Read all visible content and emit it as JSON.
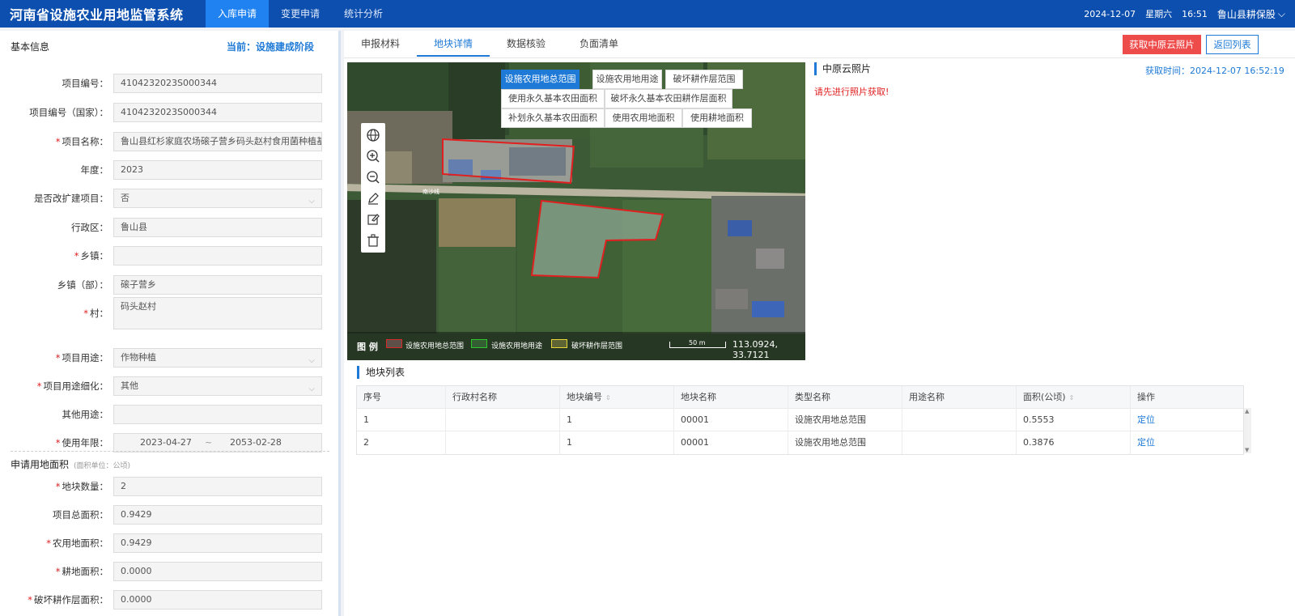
{
  "app": {
    "title": "河南省设施农业用地监管系统",
    "nav": [
      "入库申请",
      "变更申请",
      "统计分析"
    ],
    "date": "2024-12-07",
    "weekday": "星期六",
    "time": "16:51",
    "user": "鲁山县耕保股",
    "user_chevron": "⌵"
  },
  "left": {
    "section_title": "基本信息",
    "stage": "当前：设施建成阶段",
    "fields": [
      {
        "label": "项目编号：",
        "value": "4104232023S000344",
        "required": false
      },
      {
        "label": "项目编号（国家）：",
        "value": "4104232023S000344",
        "required": false
      },
      {
        "label": "项目名称：",
        "value": "鲁山县红杉家庭农场磙子营乡码头赵村食用菌种植基地",
        "required": true
      },
      {
        "label": "年度：",
        "value": "2023",
        "required": false
      },
      {
        "label": "是否改扩建项目：",
        "value": "否",
        "required": false,
        "select": true
      },
      {
        "label": "行政区：",
        "value": "鲁山县",
        "required": false
      },
      {
        "label": "乡镇：",
        "value": "",
        "required": true
      },
      {
        "label": "乡镇（部）：",
        "value": "磙子营乡",
        "required": false
      },
      {
        "label": "村：",
        "value": "码头赵村",
        "required": true
      },
      {
        "label": "项目用途：",
        "value": "作物种植",
        "required": true,
        "select": true
      },
      {
        "label": "项目用途细化：",
        "value": "其他",
        "required": true,
        "select": true
      },
      {
        "label": "其他用途：",
        "value": "",
        "required": false
      },
      {
        "label": "使用年限：",
        "value": "",
        "required": true
      }
    ],
    "date_from": "2023-04-27",
    "date_sep": "~",
    "date_to": "2053-02-28",
    "area_section": "申请用地面积",
    "area_unit": "(面积单位：公顷)",
    "area_fields": [
      {
        "label": "地块数量：",
        "value": "2",
        "required": true
      },
      {
        "label": "项目总面积：",
        "value": "0.9429",
        "required": false
      },
      {
        "label": "农用地面积：",
        "value": "0.9429",
        "required": true
      },
      {
        "label": "耕地面积：",
        "value": "0.0000",
        "required": true
      },
      {
        "label": "破坏耕作层面积：",
        "value": "0.0000",
        "required": true
      }
    ]
  },
  "right": {
    "tabs": [
      "申报材料",
      "地块详情",
      "数据核验",
      "负面清单"
    ],
    "active_tab": 1,
    "btn_fetch": "获取中原云照片",
    "btn_back": "返回列表",
    "map": {
      "layers": [
        "设施农用地总范围",
        "设施农用地用途",
        "破坏耕作层范围",
        "使用永久基本农田面积",
        "破坏永久基本农田耕作层面积",
        "补划永久基本农田面积",
        "使用农用地面积",
        "使用耕地面积"
      ],
      "road_label": "南沙线",
      "legend_title": "图 例",
      "legend_items": [
        {
          "label": "设施农用地总范围",
          "color": "#d62a2a"
        },
        {
          "label": "设施农用地用途",
          "color": "#2cc72c"
        },
        {
          "label": "破坏耕作层范围",
          "color": "#e6d63a"
        }
      ],
      "scale": "50 m",
      "coords": "113.0924, 33.7121"
    },
    "cloud": {
      "title": "中原云照片",
      "time": "获取时间：2024-12-07 16:52:19",
      "message": "请先进行照片获取!"
    },
    "parcel_list": {
      "title": "地块列表",
      "columns": [
        "序号",
        "行政村名称",
        "地块编号",
        "地块名称",
        "类型名称",
        "用途名称",
        "面积(公顷)",
        "操作"
      ],
      "rows": [
        [
          "1",
          "",
          "1",
          "00001",
          "设施农用地总范围",
          "",
          "0.5553",
          "定位"
        ],
        [
          "2",
          "",
          "1",
          "00001",
          "设施农用地总范围",
          "",
          "0.3876",
          "定位"
        ]
      ]
    }
  }
}
